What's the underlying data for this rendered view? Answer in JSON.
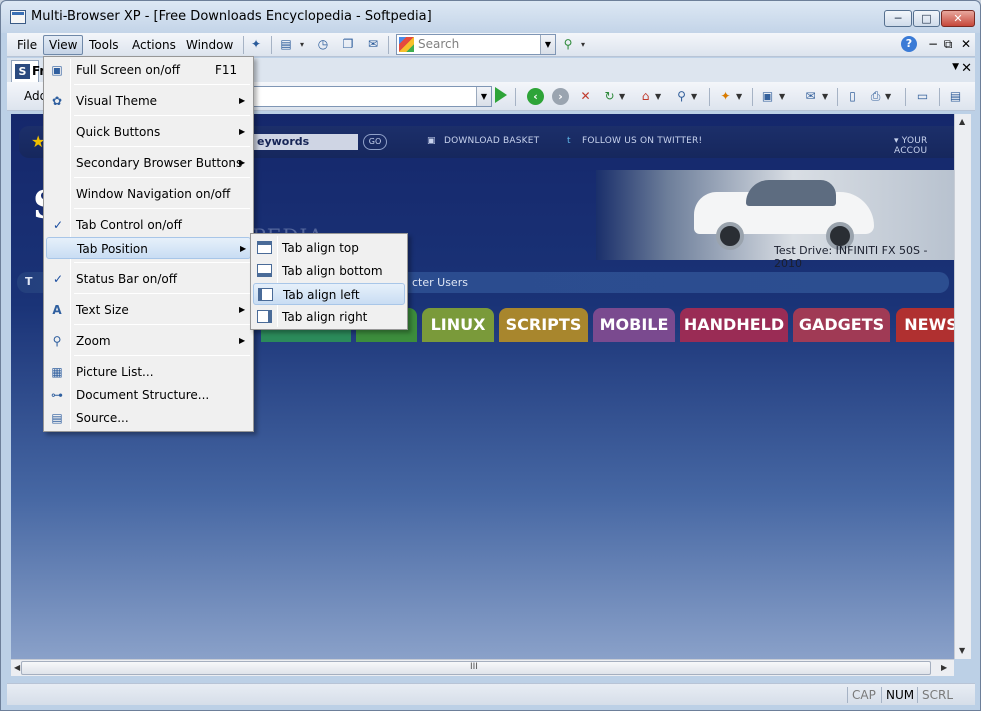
{
  "window": {
    "title": "Multi-Browser XP - [Free Downloads Encyclopedia - Softpedia]",
    "minimize_glyph": "─",
    "maximize_glyph": "□",
    "close_glyph": "✕"
  },
  "menubar": {
    "items": [
      "File",
      "View",
      "Tools",
      "Actions",
      "Window"
    ],
    "active": "View"
  },
  "search": {
    "placeholder": "Search"
  },
  "tabs": {
    "current_tab_label": "Fr",
    "tab_icon_letter": "S"
  },
  "address": {
    "label": "Add",
    "url": ""
  },
  "page": {
    "keywords_label": "eywords",
    "go_label": "GO",
    "download_basket": "DOWNLOAD BASKET",
    "twitter": "FOLLOW US ON TWITTER!",
    "account": "▾ YOUR ACCOU",
    "logo_fragment": "S",
    "watermark": "SOFTPEDIA",
    "car_caption": "Test Drive: INFINITI FX 50S  -  2010",
    "strip_t": "T",
    "strip_text": "cter Users",
    "categories": [
      {
        "label": "LINUX",
        "color": "#7a9a3a"
      },
      {
        "label": "SCRIPTS",
        "color": "#a8862d"
      },
      {
        "label": "MOBILE",
        "color": "#7a4a8f"
      },
      {
        "label": "HANDHELD",
        "color": "#9a2c55"
      },
      {
        "label": "GADGETS",
        "color": "#a03a55"
      },
      {
        "label": "NEWS",
        "color": "#b03030"
      }
    ]
  },
  "view_menu": {
    "items": [
      {
        "label": "Full Screen on/off",
        "accel": "F11"
      },
      {
        "label": "Visual Theme",
        "submenu": true
      },
      {
        "label": "Quick Buttons",
        "submenu": true
      },
      {
        "label": "Secondary Browser Buttons",
        "submenu": true
      },
      {
        "label": "Window Navigation on/off"
      },
      {
        "label": "Tab Control on/off",
        "checked": true
      },
      {
        "label": "Tab Position",
        "submenu": true,
        "highlighted": true
      },
      {
        "label": "Status Bar on/off",
        "checked": true
      },
      {
        "label": "Text Size",
        "submenu": true
      },
      {
        "label": "Zoom",
        "submenu": true
      },
      {
        "label": "Picture List..."
      },
      {
        "label": "Document Structure..."
      },
      {
        "label": "Source..."
      }
    ]
  },
  "tab_position_submenu": {
    "items": [
      "Tab align top",
      "Tab align bottom",
      "Tab align left",
      "Tab align right"
    ],
    "highlighted": "Tab align left"
  },
  "statusbar": {
    "cap": "CAP",
    "num": "NUM",
    "scrl": "SCRL"
  },
  "scroll": {
    "grip": "III"
  }
}
